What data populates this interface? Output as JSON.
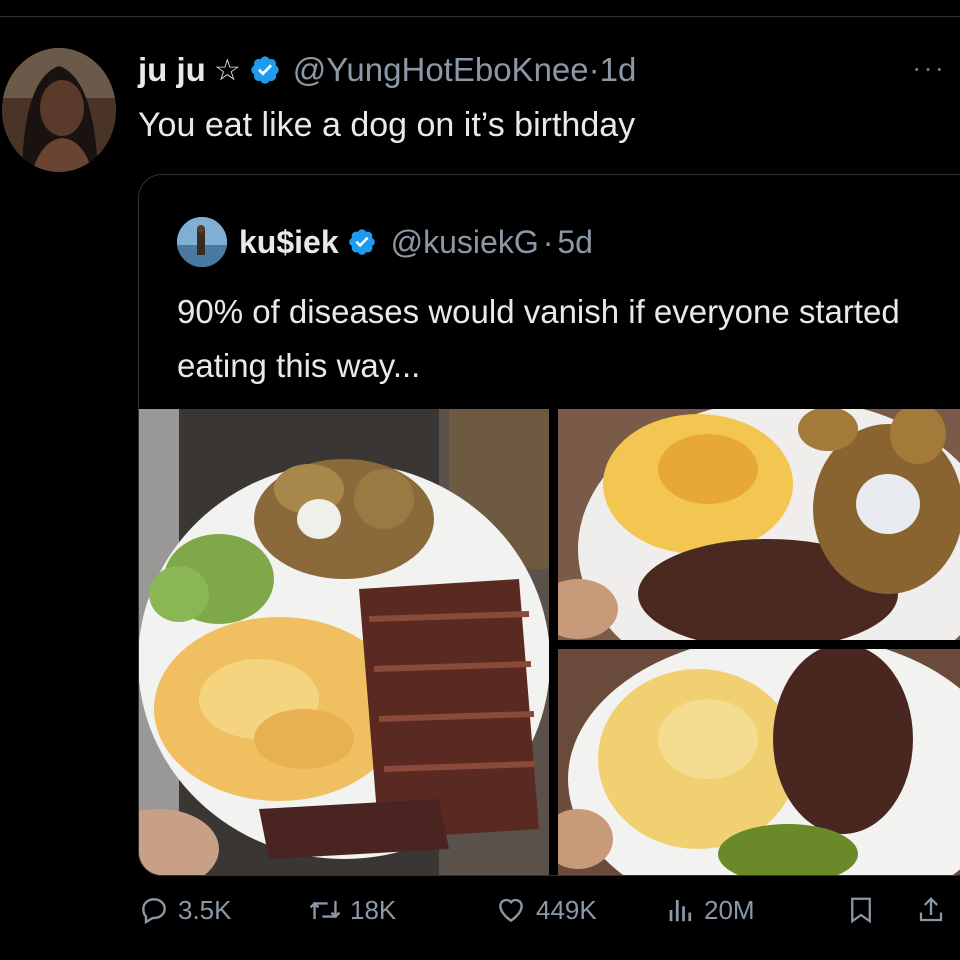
{
  "tweet": {
    "display_name": "ju ju",
    "star": "☆",
    "handle": "@YungHotEboKnee",
    "time_sep": " · ",
    "time": "1d",
    "more": "···",
    "text": "You eat like a dog on it’s birthday"
  },
  "quote": {
    "display_name": "ku$iek",
    "handle": "@kusiekG",
    "time_sep": "·",
    "time": "5d",
    "text": "90% of diseases would vanish if everyone started eating this way..."
  },
  "media": [
    {
      "name": "plate-steak-eggs-potatoes-avocado"
    },
    {
      "name": "plate-eggs-beef-potatoes"
    },
    {
      "name": "plate-eggs-beef-pickles"
    }
  ],
  "actions": {
    "replies": "3.5K",
    "reposts": "18K",
    "likes": "449K",
    "views": "20M"
  },
  "colors": {
    "background": "#000000",
    "text": "#e7e9ea",
    "secondary": "#8b98a5",
    "verified": "#1d9bf0",
    "border": "#2f3336"
  },
  "icons": [
    "star-icon",
    "verified-icon",
    "more-icon",
    "reply-icon",
    "repost-icon",
    "like-icon",
    "views-icon",
    "bookmark-icon",
    "share-icon"
  ]
}
